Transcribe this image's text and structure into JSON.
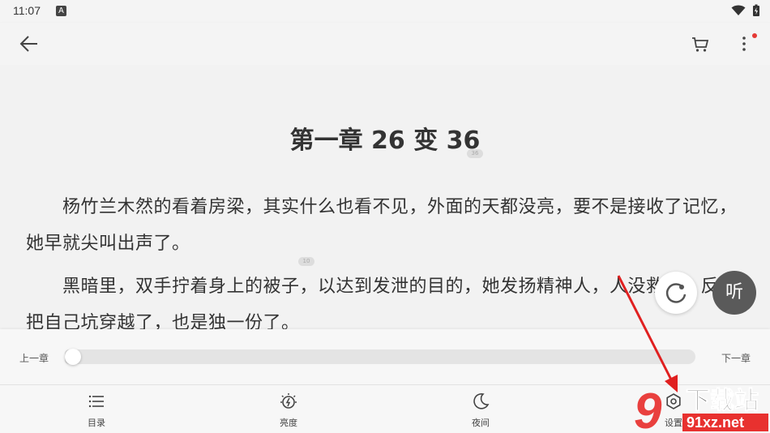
{
  "status": {
    "time": "11:07",
    "app_icon_letter": "A"
  },
  "app_bar": {
    "back_icon": "arrow-left-icon",
    "cart_icon": "cart-icon",
    "more_icon": "more-vert-icon",
    "notify_color": "#e53935"
  },
  "reader": {
    "chapter_title": "第一章 26 变 36",
    "title_badge": "36",
    "paragraphs": [
      "　　杨竹兰木然的看着房梁，其实什么也看不见，外面的天都没亮，要不是接收了记忆，她早就尖叫出声了。",
      "　　黑暗里，双手拧着身上的被子，以达到发泄的目的，她发扬精神人，人没救成，反而把自己坑穿越了，也是独一份了。"
    ],
    "para_badge": "10"
  },
  "fabs": {
    "refresh_icon": "refresh-icon",
    "listen_label": "听"
  },
  "progress": {
    "prev_label": "上一章",
    "next_label": "下一章",
    "value": 0.0
  },
  "bottom_nav": {
    "items": [
      {
        "label": "目录",
        "icon": "list-icon"
      },
      {
        "label": "亮度",
        "icon": "brightness-icon"
      },
      {
        "label": "夜间",
        "icon": "moon-icon"
      },
      {
        "label": "设置",
        "icon": "settings-icon"
      }
    ]
  },
  "watermark": {
    "big_text": "下载站",
    "site_text": "91xz.net",
    "logo_digit": "9",
    "brand_color": "#e8312f"
  },
  "colors": {
    "annotation_arrow": "#e02020",
    "background": "#f2f2f2"
  }
}
